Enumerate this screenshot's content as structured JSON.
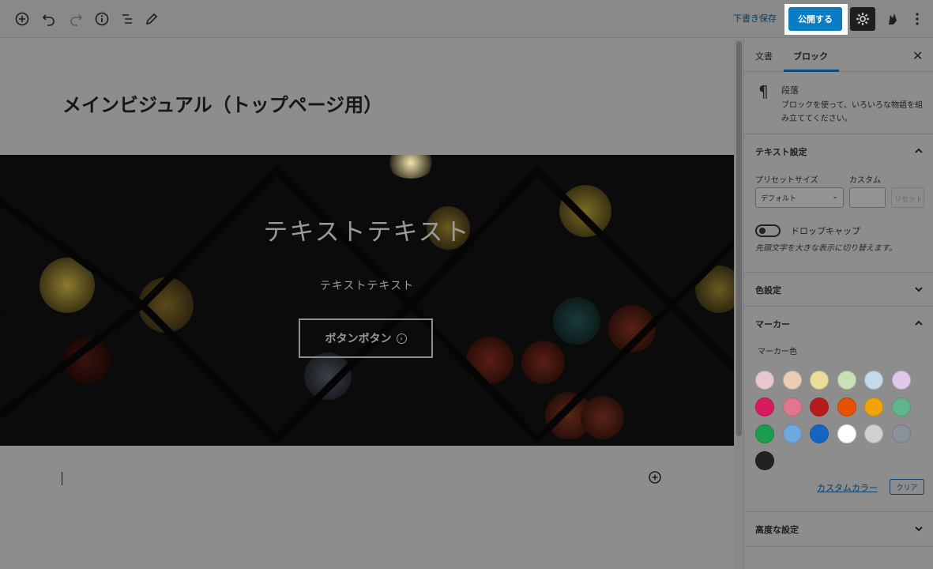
{
  "toolbar": {
    "icons": [
      "add-block-icon",
      "undo-icon",
      "redo-icon",
      "info-icon",
      "list-view-icon",
      "edit-icon"
    ],
    "save_draft": "下書き保存",
    "publish": "公開する",
    "settings_icon": "gear-icon",
    "plugin_icon": "plugin-icon",
    "more_icon": "more-vertical-icon"
  },
  "editor": {
    "title": "メインビジュアル（トップページ用）",
    "cover": {
      "heading": "テキストテキスト",
      "subtext": "テキストテキスト",
      "button_label": "ボタンボタン",
      "button_icon": "circle-arrow-icon"
    }
  },
  "sidebar": {
    "tabs": [
      {
        "label": "文書",
        "active": false
      },
      {
        "label": "ブロック",
        "active": true
      }
    ],
    "block": {
      "icon": "paragraph-icon",
      "name": "段落",
      "description": "ブロックを使って、いろいろな物語を組み立ててください。"
    },
    "text_settings": {
      "title": "テキスト設定",
      "preset_label": "プリセットサイズ",
      "custom_label": "カスタム",
      "preset_value": "デフォルト",
      "custom_value": "",
      "reset_label": "リセット",
      "dropcap_label": "ドロップキャップ",
      "dropcap_help": "先頭文字を大きな表示に切り替えます。"
    },
    "color_settings": {
      "title": "色設定"
    },
    "marker": {
      "title": "マーカー",
      "color_label": "マーカー色",
      "swatches": [
        "#e8c7cf",
        "#e9cdb6",
        "#ecdc9a",
        "#c9e1b4",
        "#c3dbe9",
        "#e2c8ea",
        "#d81b60",
        "#e3768f",
        "#b71c1c",
        "#e65100",
        "#f0a30a",
        "#62b58a",
        "#1b9d4e",
        "#6fa8dc",
        "#1565c0",
        "#ffffff",
        "#d0d0d0",
        "#8a9199",
        "#222222"
      ],
      "custom_color_label": "カスタムカラー",
      "clear_label": "クリア"
    },
    "advanced": {
      "title": "高度な設定"
    }
  }
}
